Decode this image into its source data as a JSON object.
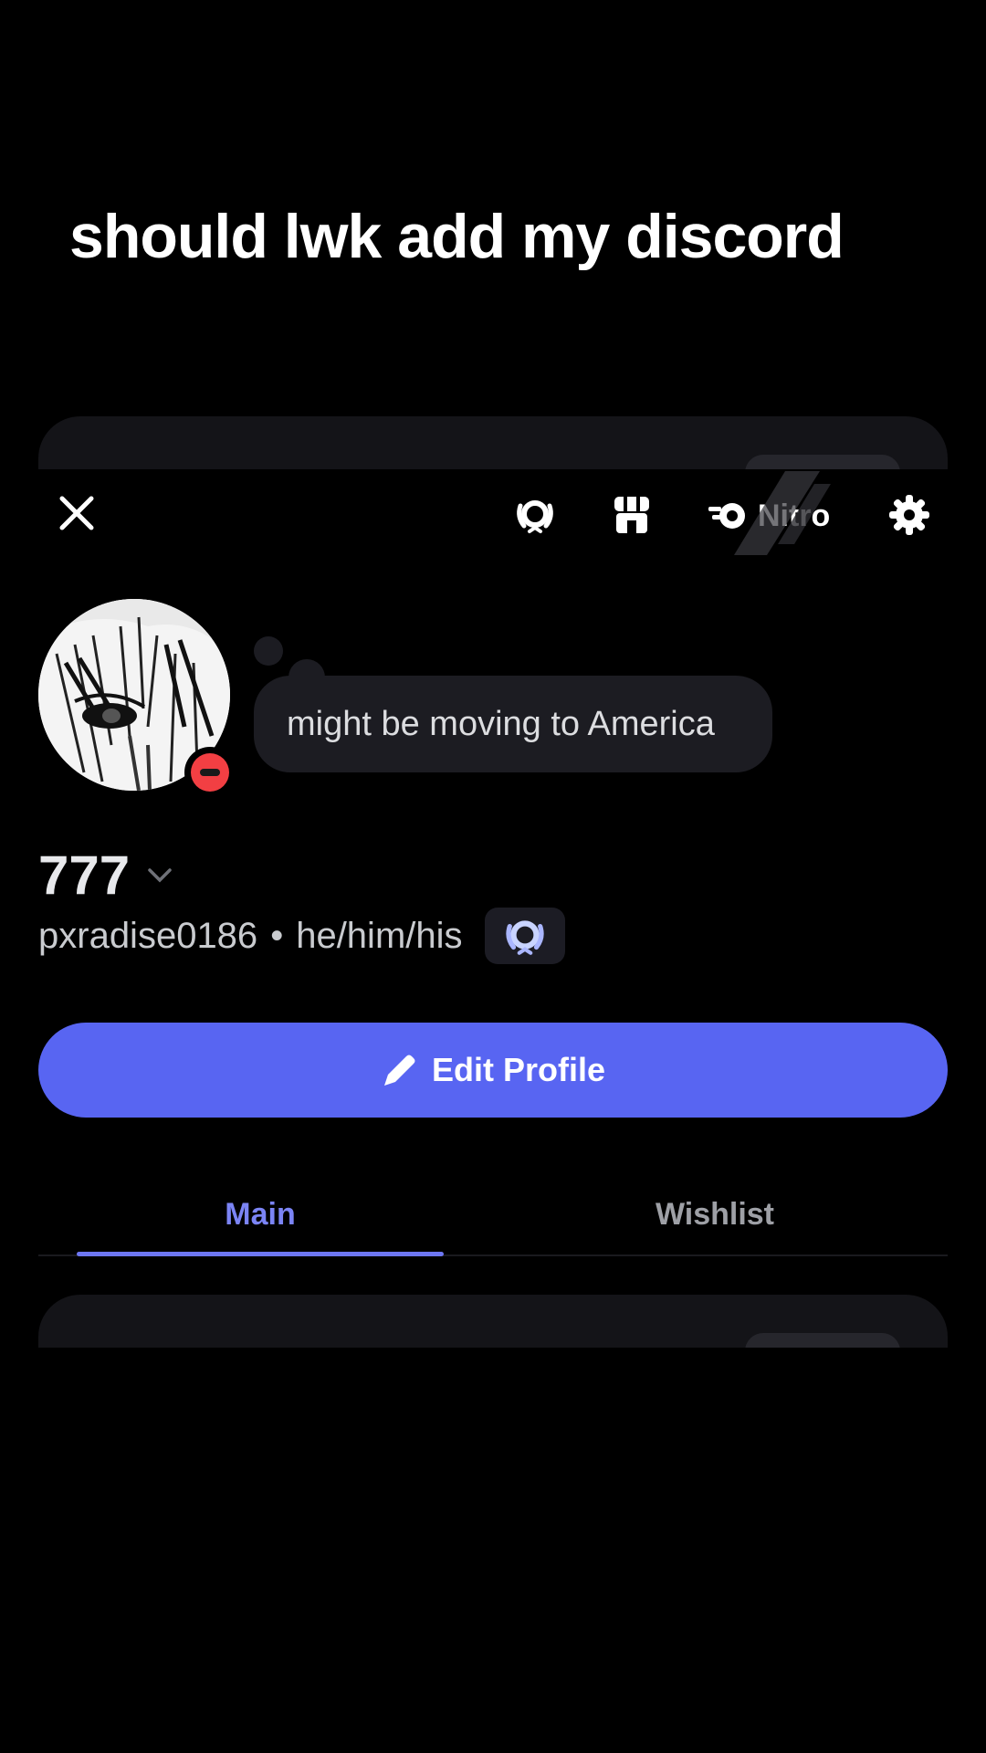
{
  "caption": "should lwk add my discord",
  "topbar": {
    "close_icon": "close-icon",
    "badge_icon": "laurel-badge-icon",
    "shop_icon": "shop-icon",
    "nitro_label": "Nitro",
    "settings_icon": "gear-icon"
  },
  "profile": {
    "custom_status": "might be moving to America",
    "display_name": "777",
    "username": "pxradise0186",
    "separator": "•",
    "pronouns": "he/him/his",
    "presence": "do-not-disturb"
  },
  "edit_button": {
    "label": "Edit Profile"
  },
  "tabs": [
    {
      "label": "Main",
      "active": true
    },
    {
      "label": "Wishlist",
      "active": false
    }
  ],
  "colors": {
    "background": "#000000",
    "accent": "#5865f2",
    "active_tab": "#7b84f5",
    "dnd": "#f23f43",
    "card": "#141418"
  }
}
